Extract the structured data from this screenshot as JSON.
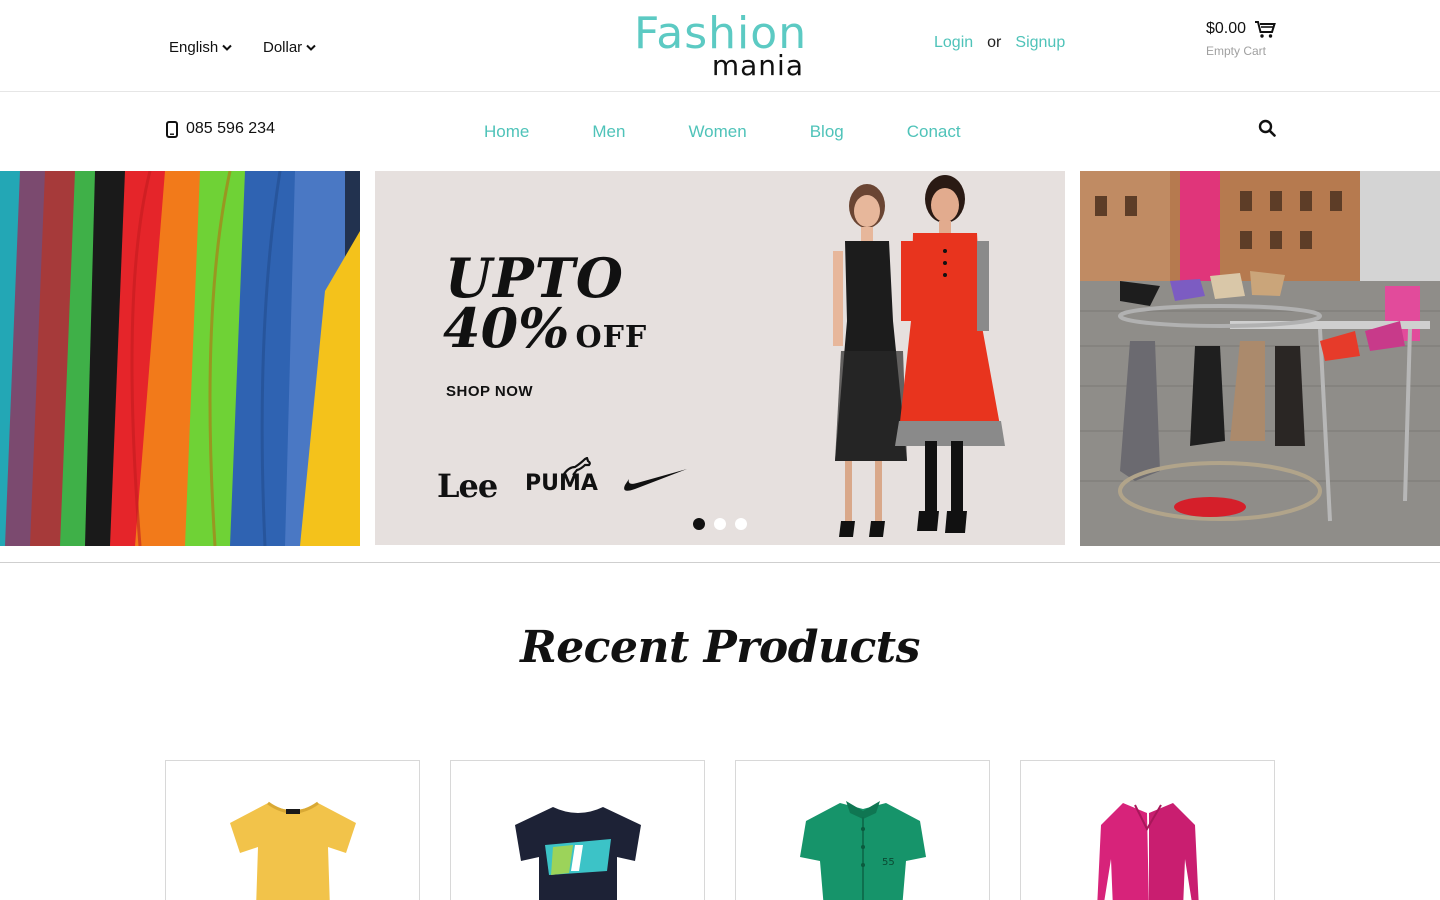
{
  "header": {
    "language": "English",
    "currency": "Dollar",
    "logo_line1": "Fashion",
    "logo_line2": "mania",
    "login_label": "Login",
    "or_label": "or",
    "signup_label": "Signup",
    "cart_amount": "$0.00",
    "cart_status": "Empty Cart"
  },
  "nav": {
    "phone": "085 596 234",
    "items": [
      {
        "label": "Home"
      },
      {
        "label": "Men"
      },
      {
        "label": "Women"
      },
      {
        "label": "Blog"
      },
      {
        "label": "Conact"
      }
    ]
  },
  "slider": {
    "headline_line1": "UPTO",
    "headline_line2": "40%",
    "headline_off": "OFF",
    "cta_label": "SHOP NOW",
    "brands": [
      "Lee",
      "PUMA"
    ],
    "active_slide": 1,
    "slide_count": 3
  },
  "recent": {
    "title": "Recent Products",
    "products": [
      {
        "image": "yellow-tshirt",
        "color": "#f2c34a"
      },
      {
        "image": "navy-nike-tshirt",
        "color": "#1d2236"
      },
      {
        "image": "green-shirt",
        "color": "#16946a"
      },
      {
        "image": "pink-cardigan",
        "color": "#d7237a"
      }
    ]
  },
  "colors": {
    "accent": "#4fc3b9",
    "logo": "#5ccac3"
  }
}
